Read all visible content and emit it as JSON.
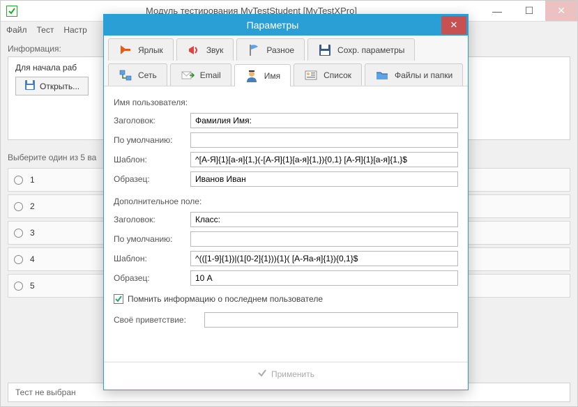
{
  "mainWindow": {
    "title": "Модуль тестирования MyTestStudent [MyTestXPro]",
    "menu": {
      "file": "Файл",
      "test": "Тест",
      "settings": "Настр"
    },
    "infoLabel": "Информация:",
    "infoText": "Для начала раб",
    "openBtn": "Открыть...",
    "chooseLabel": "Выберите один из 5 ва",
    "options": [
      "1",
      "2",
      "3",
      "4",
      "5"
    ],
    "status": "Тест не выбран"
  },
  "dialog": {
    "title": "Параметры",
    "tabs": {
      "shortcut": "Ярлык",
      "sound": "Звук",
      "misc": "Разное",
      "save": "Сохр. параметры",
      "network": "Сеть",
      "email": "Email",
      "name": "Имя",
      "list": "Список",
      "files": "Файлы и папки"
    },
    "userSection": {
      "title": "Имя пользователя:",
      "labels": {
        "header": "Заголовок:",
        "default": "По умолчанию:",
        "pattern": "Шаблон:",
        "sample": "Образец:"
      },
      "values": {
        "header": "Фамилия Имя:",
        "default": "",
        "pattern": "^[А-Я]{1}[а-я]{1,}(-[А-Я]{1}[а-я]{1,}){0,1} [А-Я]{1}[а-я]{1,}$",
        "sample": "Иванов Иван"
      }
    },
    "extraSection": {
      "title": "Дополнительное поле:",
      "labels": {
        "header": "Заголовок:",
        "default": "По умолчанию:",
        "pattern": "Шаблон:",
        "sample": "Образец:"
      },
      "values": {
        "header": "Класс:",
        "default": "",
        "pattern": "^(([1-9]{1})|(1[0-2]{1})){1}( [А-Яа-я]{1}){0,1}$",
        "sample": "10 А"
      }
    },
    "remember": "Помнить информацию о последнем пользователе",
    "greeting": "Своё приветствие:",
    "greetingValue": "",
    "apply": "Применить"
  }
}
